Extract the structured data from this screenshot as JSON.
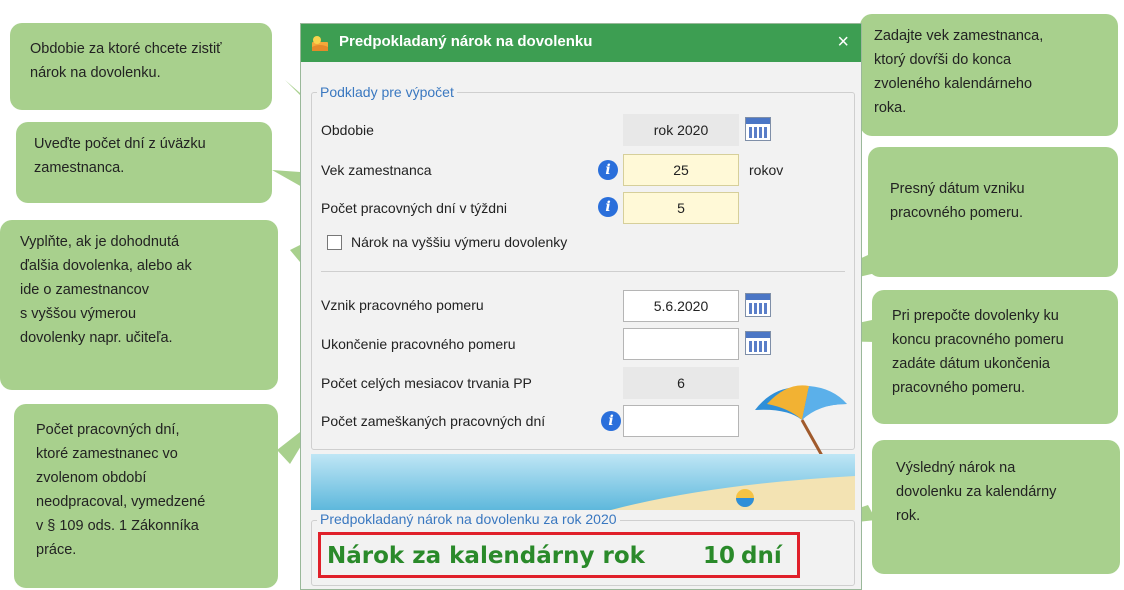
{
  "dialog": {
    "title": "Predpokladaný nárok na dovolenku",
    "close_symbol": "×",
    "group_basis": {
      "legend": "Podklady pre výpočet",
      "period_label": "Obdobie",
      "period_value": "rok 2020",
      "age_label": "Vek zamestnanca",
      "age_value": "25",
      "age_unit": "rokov",
      "workdays_label": "Počet pracovných dní v týždni",
      "workdays_value": "5",
      "higher_leave_label": "Nárok na vyššiu výmeru dovolenky",
      "higher_leave_checked": false,
      "start_label": "Vznik pracovného pomeru",
      "start_value": "5.6.2020",
      "end_label": "Ukončenie pracovného pomeru",
      "end_value": "",
      "months_label": "Počet celých mesiacov trvania PP",
      "months_value": "6",
      "missed_label": "Počet zameškaných pracovných dní",
      "missed_value": ""
    },
    "group_result": {
      "legend": "Predpokladaný nárok na dovolenku za rok 2020",
      "result_label": "Nárok za kalendárny rok",
      "result_value": "10",
      "result_unit": "dní"
    }
  },
  "callouts": {
    "period": "Obdobie za ktoré chcete zistiť nárok na dovolenku.",
    "workload": "Uveďte počet dní z úväzku zamestnanca.",
    "higher": [
      "Vyplňte, ak je dohodnutá",
      "ďalšia dovolenka, alebo ak",
      "ide o zamestnancov",
      "s vyššou výmerou",
      "dovolenky napr. učiteľa."
    ],
    "missed": [
      "Počet pracovných dní,",
      "ktoré zamestnanec vo",
      "zvolenom období",
      "neodpracoval, vymedzené",
      "v § 109 ods. 1 Zákonníka",
      "práce."
    ],
    "age": [
      "Zadajte vek zamestnanca,",
      "ktorý dovŕši do konca",
      "zvoleného kalendárneho",
      "roka."
    ],
    "start": [
      "Presný dátum vzniku",
      "pracovného pomeru."
    ],
    "end": [
      "Pri prepočte dovolenky ku",
      "koncu pracovného pomeru",
      "zadáte dátum ukončenia",
      "pracovného pomeru."
    ],
    "result": [
      "Výsledný nárok na",
      "dovolenku za kalendárny",
      "rok."
    ]
  },
  "colors": {
    "titlebar": "#3d9e52",
    "callout": "#a8d08d",
    "result_text": "#2a8a2a",
    "result_border": "#e0202a",
    "legend_text": "#3a78c0"
  }
}
